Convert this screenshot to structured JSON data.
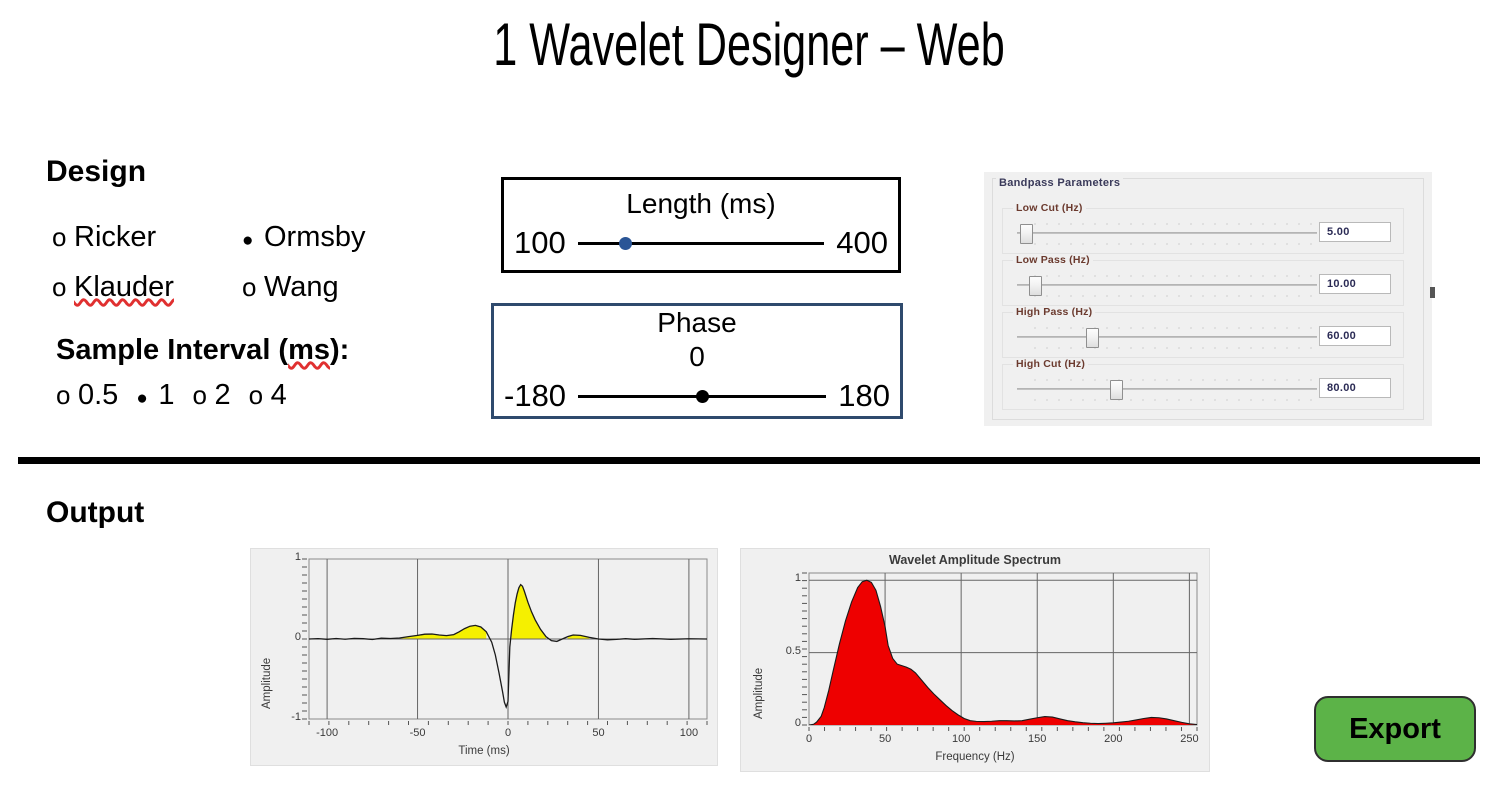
{
  "app": {
    "title": "1 Wavelet Designer – Web"
  },
  "design": {
    "heading": "Design",
    "wavelet_types": [
      {
        "label": "Ricker",
        "selected": false
      },
      {
        "label": "Ormsby",
        "selected": true
      },
      {
        "label": "Klauder",
        "selected": false,
        "misspelled": true
      },
      {
        "label": "Wang",
        "selected": false
      }
    ],
    "sample_interval": {
      "label": "Sample Interval (ms):",
      "options": [
        {
          "label": "0.5",
          "selected": false
        },
        {
          "label": "1",
          "selected": true
        },
        {
          "label": "2",
          "selected": false
        },
        {
          "label": "4",
          "selected": false
        }
      ]
    }
  },
  "length_slider": {
    "title": "Length (ms)",
    "min_label": "100",
    "max_label": "400",
    "min": 100,
    "max": 400,
    "value": 157,
    "thumb_percent": 19,
    "thumb_color": "#2a5596"
  },
  "phase_slider": {
    "title": "Phase",
    "value_label": "0",
    "min_label": "-180",
    "max_label": "180",
    "min": -180,
    "max": 180,
    "value": 0,
    "thumb_percent": 50,
    "thumb_color": "#000000"
  },
  "bandpass": {
    "legend": "Bandpass Parameters",
    "sliders": [
      {
        "label": "Low Cut (Hz)",
        "value": "5.00",
        "thumb_percent": 3
      },
      {
        "label": "Low Pass (Hz)",
        "value": "10.00",
        "thumb_percent": 6
      },
      {
        "label": "High Pass (Hz)",
        "value": "60.00",
        "thumb_percent": 25
      },
      {
        "label": "High Cut (Hz)",
        "value": "80.00",
        "thumb_percent": 33
      }
    ]
  },
  "output": {
    "heading": "Output",
    "export_label": "Export"
  },
  "colors": {
    "accent_green": "#5cb348",
    "wavelet_fill": "#f5f000",
    "spectrum_fill": "#ee0000",
    "slider_blue": "#2a5596",
    "phase_border": "#2f4a6d"
  },
  "chart_data": [
    {
      "type": "line",
      "name": "wavelet-time-series",
      "title": "",
      "xlabel": "Time (ms)",
      "ylabel": "Amplitude",
      "xlim": [
        -110,
        110
      ],
      "ylim": [
        -1,
        1
      ],
      "xticks": [
        -100,
        -50,
        0,
        50,
        100
      ],
      "xtick_labels": [
        "-100",
        "-50",
        "0",
        "50",
        "100"
      ],
      "yticks": [
        -1,
        0,
        1
      ],
      "ytick_labels": [
        "-1",
        "0",
        "1"
      ],
      "grid": true,
      "fill_positive_color": "#f5f000",
      "line_color": "#1a1a1a",
      "x": [
        -110,
        -105,
        -100,
        -95,
        -90,
        -85,
        -80,
        -75,
        -70,
        -65,
        -60,
        -55,
        -50,
        -46,
        -42,
        -38,
        -34,
        -30,
        -27,
        -24,
        -21,
        -18,
        -15,
        -12,
        -9,
        -7,
        -5,
        -3,
        -2,
        -1,
        0,
        1,
        2,
        3,
        4,
        5,
        6,
        7,
        8,
        9,
        11,
        13,
        15,
        18,
        21,
        24,
        27,
        30,
        33,
        36,
        40,
        45,
        50,
        55,
        60,
        65,
        70,
        80,
        90,
        100,
        110
      ],
      "y": [
        0.0,
        0.005,
        -0.004,
        0.006,
        -0.003,
        0.008,
        0.004,
        -0.006,
        0.01,
        0.006,
        0.012,
        0.03,
        0.045,
        0.06,
        0.062,
        0.05,
        0.042,
        0.055,
        0.09,
        0.13,
        0.16,
        0.17,
        0.15,
        0.09,
        -0.04,
        -0.2,
        -0.42,
        -0.66,
        -0.79,
        -0.85,
        -0.78,
        -0.1,
        0.12,
        0.3,
        0.45,
        0.56,
        0.64,
        0.68,
        0.66,
        0.6,
        0.46,
        0.34,
        0.24,
        0.12,
        0.03,
        -0.02,
        -0.03,
        0.0,
        0.03,
        0.05,
        0.045,
        0.02,
        0.0,
        -0.01,
        -0.005,
        0.004,
        -0.004,
        0.006,
        -0.004,
        0.003,
        0.0
      ]
    },
    {
      "type": "area",
      "name": "wavelet-amplitude-spectrum",
      "title": "Wavelet Amplitude Spectrum",
      "xlabel": "Frequency (Hz)",
      "ylabel": "Amplitude",
      "xlim": [
        0,
        255
      ],
      "ylim": [
        0,
        1.05
      ],
      "xticks": [
        0,
        50,
        100,
        150,
        200,
        250
      ],
      "xtick_labels": [
        "0",
        "50",
        "100",
        "150",
        "200",
        "250"
      ],
      "yticks": [
        0,
        0.5,
        1
      ],
      "ytick_labels": [
        "0",
        "0.5",
        "1"
      ],
      "grid": true,
      "fill_color": "#ee0000",
      "line_color": "#1a1a1a",
      "x": [
        0,
        3,
        5,
        8,
        10,
        13,
        16,
        20,
        24,
        28,
        32,
        35,
        38,
        41,
        44,
        47,
        50,
        52,
        55,
        58,
        61,
        64,
        67,
        70,
        74,
        78,
        82,
        86,
        90,
        94,
        98,
        102,
        106,
        110,
        115,
        120,
        125,
        130,
        135,
        140,
        145,
        150,
        155,
        160,
        165,
        170,
        175,
        180,
        185,
        190,
        195,
        200,
        205,
        210,
        215,
        220,
        225,
        230,
        235,
        240,
        245,
        250,
        255
      ],
      "y": [
        0.0,
        0.005,
        0.02,
        0.06,
        0.12,
        0.24,
        0.38,
        0.56,
        0.72,
        0.85,
        0.95,
        0.99,
        1.0,
        0.985,
        0.93,
        0.82,
        0.68,
        0.55,
        0.46,
        0.42,
        0.41,
        0.4,
        0.385,
        0.36,
        0.31,
        0.26,
        0.215,
        0.175,
        0.135,
        0.1,
        0.07,
        0.045,
        0.03,
        0.025,
        0.024,
        0.026,
        0.03,
        0.03,
        0.028,
        0.03,
        0.04,
        0.05,
        0.058,
        0.055,
        0.042,
        0.03,
        0.022,
        0.016,
        0.012,
        0.01,
        0.012,
        0.015,
        0.02,
        0.026,
        0.035,
        0.045,
        0.052,
        0.05,
        0.042,
        0.03,
        0.018,
        0.008,
        0.003
      ]
    }
  ]
}
